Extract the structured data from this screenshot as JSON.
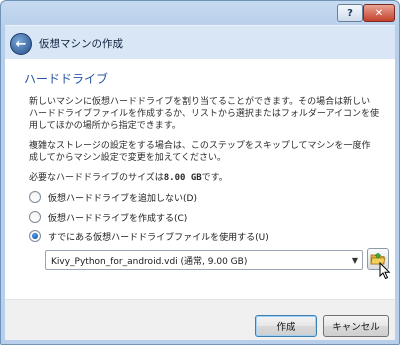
{
  "window": {
    "title": "仮想マシンの作成",
    "help_label": "?",
    "close_label": "✕"
  },
  "page": {
    "heading": "ハードドライブ",
    "paragraph1": "新しいマシンに仮想ハードドライブを割り当てることができます。その場合は新しいハードドライブファイルを作成するか、リストから選択またはフォルダーアイコンを使用してほかの場所から指定できます。",
    "paragraph2": "複雑なストレージの設定をする場合は、このステップをスキップしてマシンを一度作成してからマシン設定で変更を加えてください。",
    "size_prefix": "必要なハードドライブのサイズは",
    "size_value": "8.00 GB",
    "size_suffix": "です。"
  },
  "options": [
    {
      "label": "仮想ハードドライブを追加しない(D)",
      "checked": false
    },
    {
      "label": "仮想ハードドライブを作成する(C)",
      "checked": false
    },
    {
      "label": "すでにある仮想ハードドライブファイルを使用する(U)",
      "checked": true
    }
  ],
  "disk_select": {
    "value": "Kivy_Python_for_android.vdi (通常, 9.00 GB)"
  },
  "buttons": {
    "create": "作成",
    "cancel": "キャンセル"
  },
  "icons": {
    "back": "back-arrow-icon",
    "folder": "folder-open-icon",
    "dropdown": "chevron-down-icon",
    "cursor": "mouse-pointer-icon"
  }
}
